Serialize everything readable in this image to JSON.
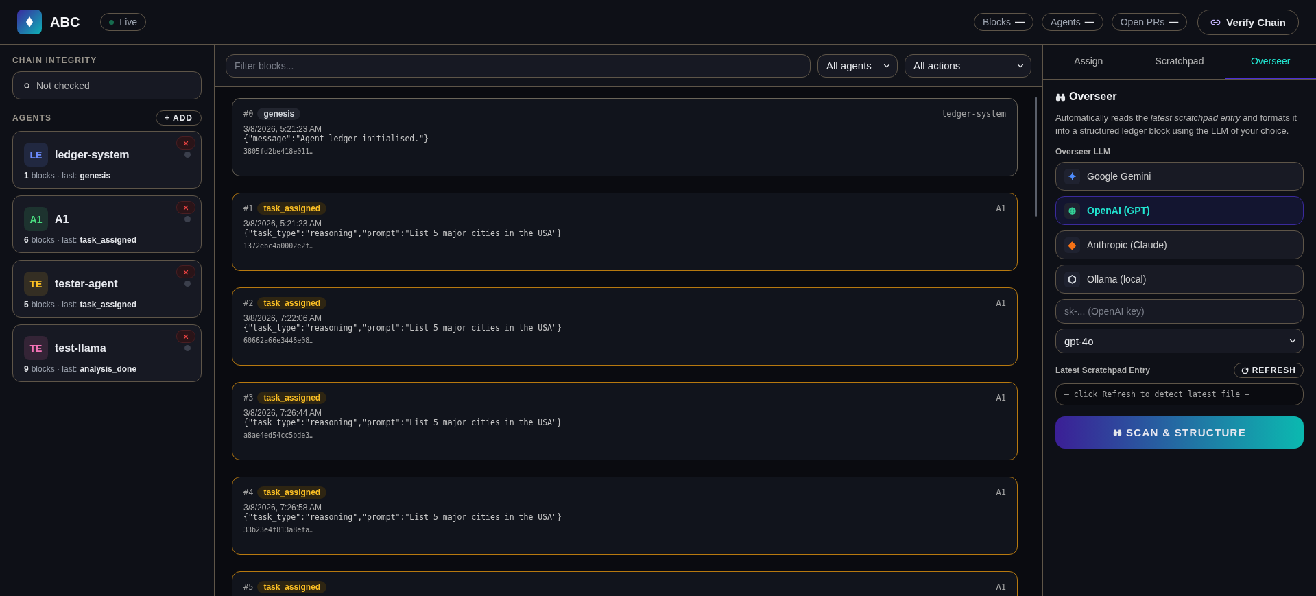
{
  "brand": {
    "name": "ABC",
    "status": "Live"
  },
  "stats": [
    {
      "label": "Blocks",
      "value": "—"
    },
    {
      "label": "Agents",
      "value": "—"
    },
    {
      "label": "Open PRs",
      "value": "—"
    }
  ],
  "verify_button": "Verify Chain",
  "sidebar": {
    "integrity_title": "CHAIN INTEGRITY",
    "integrity_status": "Not checked",
    "agents_title": "AGENTS",
    "add_button": "+ ADD",
    "agents": [
      {
        "initials": "LE",
        "name": "ledger-system",
        "count": "1",
        "count_label": "blocks · last:",
        "last": "genesis",
        "color": "#6b8cff"
      },
      {
        "initials": "A1",
        "name": "A1",
        "count": "6",
        "count_label": "blocks · last:",
        "last": "task_assigned",
        "color": "#4ade80"
      },
      {
        "initials": "TE",
        "name": "tester-agent",
        "count": "5",
        "count_label": "blocks · last:",
        "last": "task_assigned",
        "color": "#fbbf24"
      },
      {
        "initials": "TE",
        "name": "test-llama",
        "count": "9",
        "count_label": "blocks · last:",
        "last": "analysis_done",
        "color": "#f472b6"
      }
    ]
  },
  "filters": {
    "placeholder": "Filter blocks...",
    "agent_select": "All agents",
    "action_select": "All actions"
  },
  "blocks": [
    {
      "kind": "genesis",
      "index": "#0",
      "action": "genesis",
      "agent": "ledger-system",
      "time": "3/8/2026, 5:21:23 AM",
      "payload": "{\"message\":\"Agent ledger initialised.\"}",
      "hash": "3805fd2be418e011…"
    },
    {
      "kind": "task",
      "index": "#1",
      "action": "task_assigned",
      "agent": "A1",
      "time": "3/8/2026, 5:21:23 AM",
      "payload": "{\"task_type\":\"reasoning\",\"prompt\":\"List 5 major cities in the USA\"}",
      "hash": "1372ebc4a0002e2f…"
    },
    {
      "kind": "task",
      "index": "#2",
      "action": "task_assigned",
      "agent": "A1",
      "time": "3/8/2026, 7:22:06 AM",
      "payload": "{\"task_type\":\"reasoning\",\"prompt\":\"List 5 major cities in the USA\"}",
      "hash": "60662a66e3446e08…"
    },
    {
      "kind": "task",
      "index": "#3",
      "action": "task_assigned",
      "agent": "A1",
      "time": "3/8/2026, 7:26:44 AM",
      "payload": "{\"task_type\":\"reasoning\",\"prompt\":\"List 5 major cities in the USA\"}",
      "hash": "a8ae4ed54cc5bde3…"
    },
    {
      "kind": "task",
      "index": "#4",
      "action": "task_assigned",
      "agent": "A1",
      "time": "3/8/2026, 7:26:58 AM",
      "payload": "{\"task_type\":\"reasoning\",\"prompt\":\"List 5 major cities in the USA\"}",
      "hash": "33b23e4f813a8efa…"
    },
    {
      "kind": "task",
      "index": "#5",
      "action": "task_assigned",
      "agent": "A1"
    }
  ],
  "tabs": [
    {
      "label": "Assign",
      "selected": false
    },
    {
      "label": "Scratchpad",
      "selected": false
    },
    {
      "label": "Overseer",
      "selected": true
    }
  ],
  "overseer": {
    "title": "Overseer",
    "description": "Automatically reads the *latest scratchpad entry* and formats it into a structured ledger block using the LLM of your choice.",
    "llm_label": "Overseer LLM",
    "llms": [
      {
        "icon": "✦",
        "label": "Google Gemini",
        "selected": false,
        "color": "#4f8dff"
      },
      {
        "icon": "⊕",
        "label": "OpenAI (GPT)",
        "selected": true,
        "color": "#34d399"
      },
      {
        "icon": "◈",
        "label": "Anthropic (Claude)",
        "selected": false,
        "color": "#f97316"
      },
      {
        "icon": "⬡",
        "label": "Ollama (local)",
        "selected": false,
        "color": "#d1d5db"
      }
    ],
    "key_placeholder": "sk-... (OpenAI key)",
    "model": "gpt-4o",
    "entry_label": "Latest Scratchpad Entry",
    "refresh_button": "REFRESH",
    "entry_value": "— click Refresh to detect latest file —",
    "scan_button": "SCAN & STRUCTURE"
  }
}
